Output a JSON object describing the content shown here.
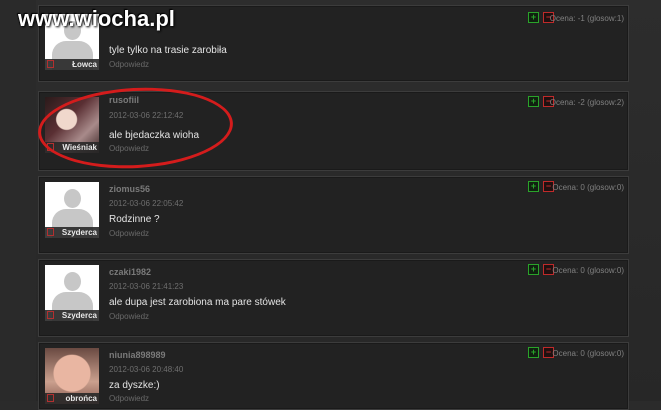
{
  "site": {
    "logo_text": "www.wiocha.pl"
  },
  "ui": {
    "rating_label": "Ocena:",
    "reply_label": "Odpowiedz"
  },
  "comments": [
    {
      "username": "",
      "date": "",
      "text": "tyle tylko na trasie zarobiła",
      "rank": "Łowca",
      "rating": "-1 (glosow:1)",
      "avatar": "default-silhouette"
    },
    {
      "username": "rusofiil",
      "date": "2012-03-06 22:12:42",
      "text": "ale bjedaczka wioha",
      "rank": "Wieśniak",
      "rating": "-2 (glosow:2)",
      "avatar": "photo-girl"
    },
    {
      "username": "ziomus56",
      "date": "2012-03-06 22:05:42",
      "text": "Rodzinne ?",
      "rank": "Szyderca",
      "rating": "0 (glosow:0)",
      "avatar": "default-silhouette"
    },
    {
      "username": "czaki1982",
      "date": "2012-03-06 21:41:23",
      "text": "ale dupa jest zarobiona ma pare stówek",
      "rank": "Szyderca",
      "rating": "0 (glosow:0)",
      "avatar": "default-silhouette"
    },
    {
      "username": "niunia898989",
      "date": "2012-03-06 20:48:40",
      "text": "za dyszke:)",
      "rank": "obrońca wiochy",
      "rating": "0 (glosow:0)",
      "avatar": "photo-baby"
    }
  ],
  "colors": {
    "background": "#2b2b2b",
    "card": "#222222",
    "vote_up": "#2aa32a",
    "vote_down": "#c02a2a",
    "annotation": "#d41c1c"
  },
  "icons": {
    "vote_up": "plus-icon",
    "vote_down": "minus-icon"
  }
}
